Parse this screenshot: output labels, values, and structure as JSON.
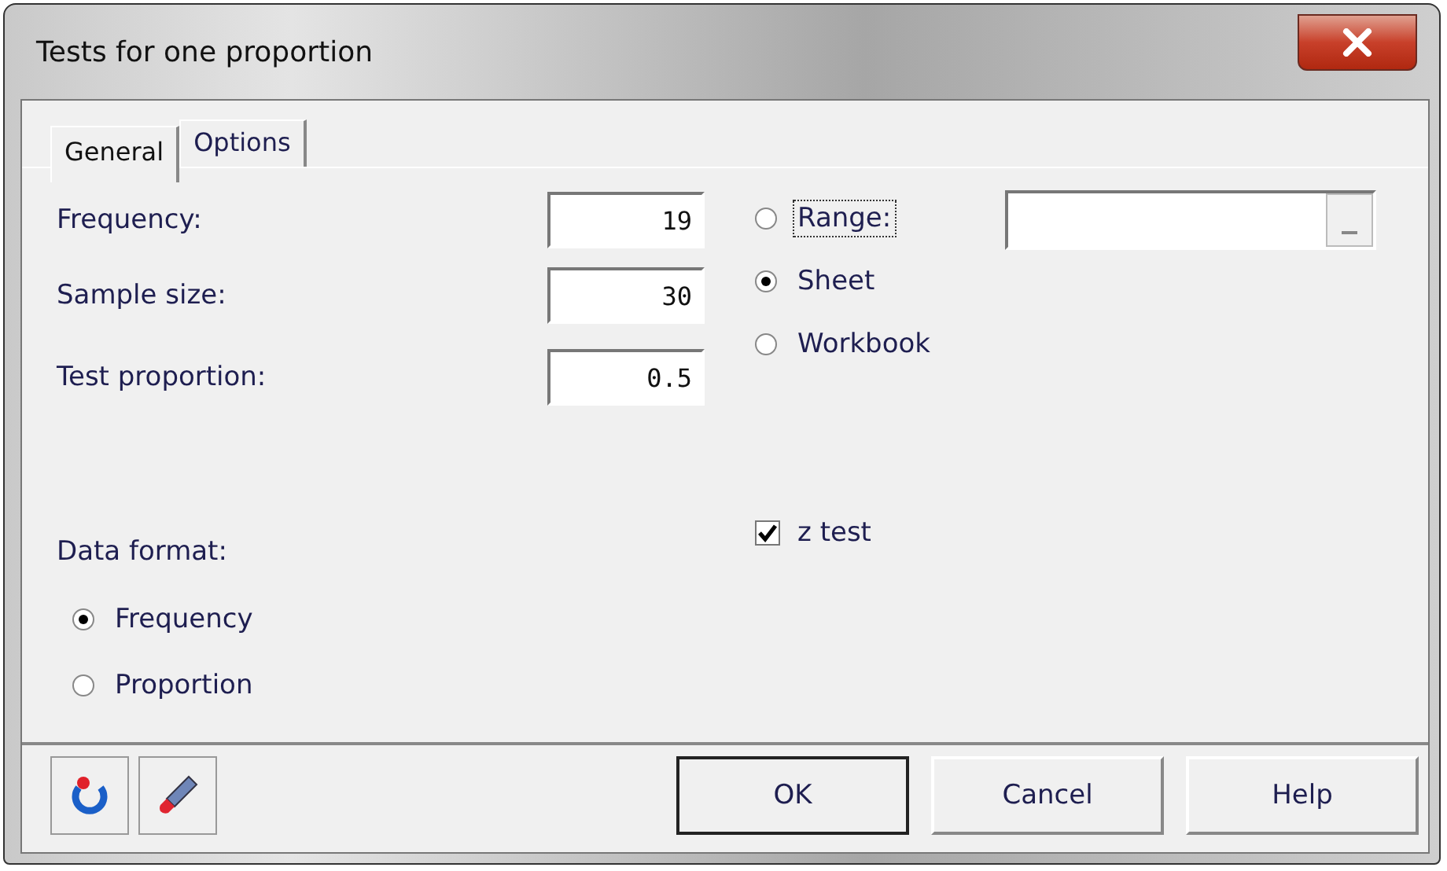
{
  "window": {
    "title": "Tests for one proportion"
  },
  "tabs": [
    {
      "label": "General",
      "selected": true
    },
    {
      "label": "Options",
      "selected": false
    }
  ],
  "fields": [
    {
      "label": "Frequency:",
      "value": "19"
    },
    {
      "label": "Sample size:",
      "value": "30"
    },
    {
      "label": "Test proportion:",
      "value": "0.5"
    }
  ],
  "source_options": [
    {
      "label": "Range:",
      "selected": false,
      "focused": true
    },
    {
      "label": "Sheet",
      "selected": true,
      "focused": false
    },
    {
      "label": "Workbook",
      "selected": false,
      "focused": false
    }
  ],
  "data_format": {
    "label": "Data format:",
    "options": [
      {
        "label": "Frequency",
        "selected": true
      },
      {
        "label": "Proportion",
        "selected": false
      }
    ]
  },
  "checkboxes": [
    {
      "label": "z test",
      "checked": true
    }
  ],
  "buttons": [
    {
      "label": "OK",
      "default": true
    },
    {
      "label": "Cancel",
      "default": false
    },
    {
      "label": "Help",
      "default": false
    }
  ]
}
